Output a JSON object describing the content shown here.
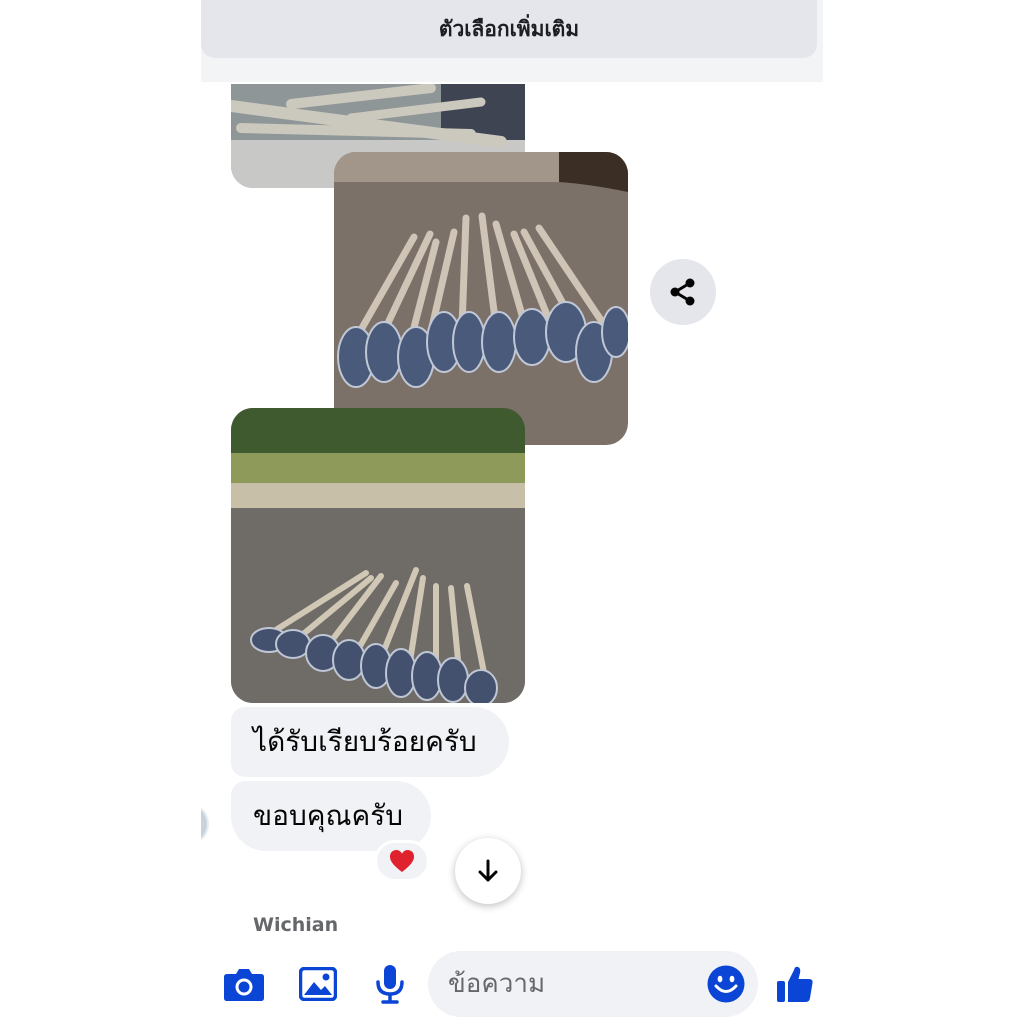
{
  "header": {
    "title": "ตัวเลือกเพิ่มเติม"
  },
  "messages": [
    {
      "text": "ได้รับเรียบร้อยครับ"
    },
    {
      "text": "ขอบคุณครับ"
    }
  ],
  "reaction": {
    "emoji": "❤️"
  },
  "sender": {
    "name": "Wichian"
  },
  "composer": {
    "placeholder": "ข้อความ"
  },
  "icons": {
    "share": "share-icon",
    "scroll": "arrow-down-icon",
    "camera": "camera-icon",
    "gallery": "image-icon",
    "mic": "microphone-icon",
    "emoji": "smiley-icon",
    "like": "thumbs-up-icon"
  },
  "colors": {
    "accent": "#0a45d6",
    "bubble": "#f0f2f5",
    "header": "#e4e6eb",
    "reaction": "#e0222f"
  }
}
